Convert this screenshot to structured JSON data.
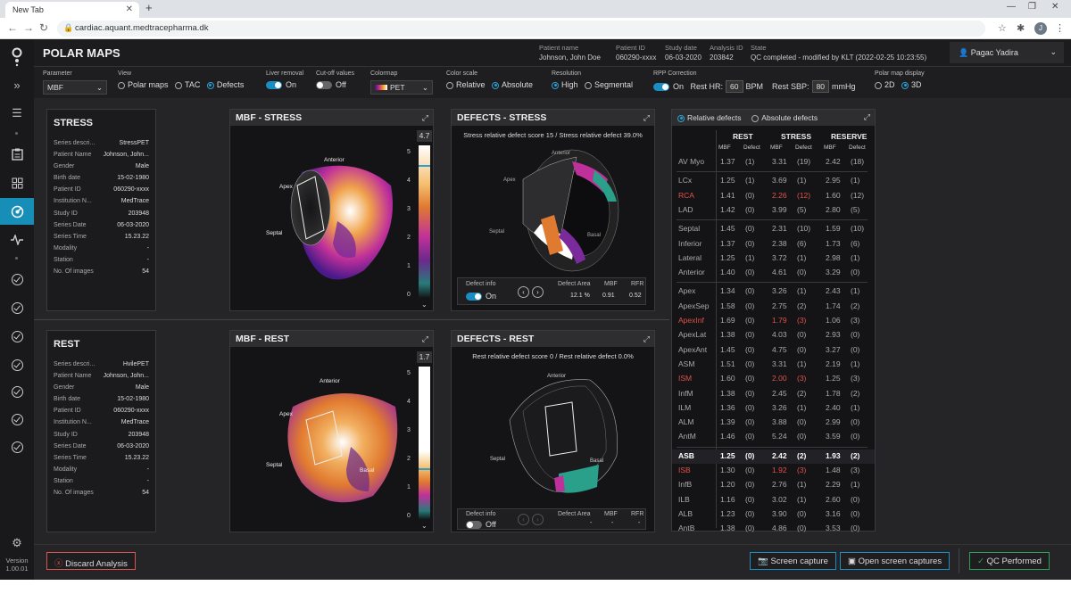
{
  "browser": {
    "tab_title": "New Tab",
    "url": "cardiac.aquant.medtracepharma.dk",
    "profile_initial": "J"
  },
  "app": {
    "title": "POLAR MAPS",
    "version_label": "Version",
    "version": "1.00.01"
  },
  "patient": {
    "name_label": "Patient name",
    "name": "Johnson, John Doe",
    "id_label": "Patient ID",
    "id": "060290-xxxx",
    "date_label": "Study date",
    "date": "06-03-2020",
    "analysis_label": "Analysis ID",
    "analysis": "203842",
    "state_label": "State",
    "state": "QC completed - modified by KLT  (2022-02-25 10:23:55)"
  },
  "user": {
    "name": "Pagac Yadira"
  },
  "params": {
    "parameter_label": "Parameter",
    "parameter_value": "MBF",
    "view_label": "View",
    "view_options": [
      "Polar maps",
      "TAC",
      "Defects"
    ],
    "liver_label": "Liver removal",
    "liver_state": "On",
    "cutoff_label": "Cut-off values",
    "cutoff_state": "Off",
    "colormap_label": "Colormap",
    "colormap_value": "PET",
    "colorscale_label": "Color scale",
    "colorscale_options": [
      "Relative",
      "Absolute"
    ],
    "resolution_label": "Resolution",
    "resolution_options": [
      "High",
      "Segmental"
    ],
    "rpp_label": "RPP Correction",
    "rpp_state": "On",
    "resthr_label": "Rest HR:",
    "resthr_value": "60",
    "resthr_unit": "BPM",
    "restsbp_label": "Rest SBP:",
    "restsbp_value": "80",
    "restsbp_unit": "mmHg",
    "polar_label": "Polar map display",
    "polar_options": [
      "2D",
      "3D"
    ]
  },
  "stress_info": {
    "title": "STRESS",
    "rows": [
      {
        "k": "Series descri...",
        "v": "StressPET"
      },
      {
        "k": "Patient Name",
        "v": "Johnson, John..."
      },
      {
        "k": "Gender",
        "v": "Male"
      },
      {
        "k": "Birth date",
        "v": "15-02-1980"
      },
      {
        "k": "Patient ID",
        "v": "060290-xxxx"
      },
      {
        "k": "Institution N...",
        "v": "MedTrace"
      },
      {
        "k": "Study ID",
        "v": "203948"
      },
      {
        "k": "Series Date",
        "v": "06-03-2020"
      },
      {
        "k": "Series Time",
        "v": "15.23.22"
      },
      {
        "k": "Modality",
        "v": "-"
      },
      {
        "k": "Station",
        "v": "-"
      },
      {
        "k": "No. Of images",
        "v": "54"
      }
    ]
  },
  "rest_info": {
    "title": "REST",
    "rows": [
      {
        "k": "Series descri...",
        "v": "HvilePET"
      },
      {
        "k": "Patient Name",
        "v": "Johnson, John..."
      },
      {
        "k": "Gender",
        "v": "Male"
      },
      {
        "k": "Birth date",
        "v": "15-02-1980"
      },
      {
        "k": "Patient ID",
        "v": "060290-xxxx"
      },
      {
        "k": "Institution N...",
        "v": "MedTrace"
      },
      {
        "k": "Study ID",
        "v": "203948"
      },
      {
        "k": "Series Date",
        "v": "06-03-2020"
      },
      {
        "k": "Series Time",
        "v": "15.23.22"
      },
      {
        "k": "Modality",
        "v": "-"
      },
      {
        "k": "Station",
        "v": "-"
      },
      {
        "k": "No. Of images",
        "v": "54"
      }
    ]
  },
  "mbf_stress": {
    "title": "MBF - STRESS",
    "max": "4.7",
    "ticks": [
      "5",
      "4",
      "3",
      "2",
      "1",
      "0"
    ],
    "labels": {
      "anterior": "Anterior",
      "apex": "Apex",
      "septal": "Septal"
    }
  },
  "mbf_rest": {
    "title": "MBF  - REST",
    "max": "1.7",
    "ticks": [
      "5",
      "4",
      "3",
      "2",
      "1",
      "0"
    ],
    "labels": {
      "anterior": "Anterior",
      "apex": "Apex",
      "septal": "Septal",
      "basal": "Basal"
    }
  },
  "def_stress": {
    "title": "DEFECTS - STRESS",
    "caption": "Stress relative defect score 15 / Stress relative defect 39.0%",
    "labels": {
      "anterior": "Anterior",
      "apex": "Apex",
      "septal": "Septal",
      "basal": "Basal"
    },
    "info_label": "Defect info",
    "info_state": "On",
    "area_label": "Defect Area",
    "area": "12.1 %",
    "mbf_label": "MBF",
    "mbf": "0.91",
    "rfr_label": "RFR",
    "rfr": "0.52"
  },
  "def_rest": {
    "title": "DEFECTS - REST",
    "caption": "Rest relative defect score 0 / Rest relative defect 0.0%",
    "labels": {
      "anterior": "Anterior",
      "septal": "Septal",
      "basal": "Basal"
    },
    "info_label": "Defect info",
    "info_state": "Off",
    "area_label": "Defect Area",
    "area": "-",
    "mbf_label": "MBF",
    "mbf": "-",
    "rfr_label": "RFR",
    "rfr": "-"
  },
  "table": {
    "options": [
      "Relative defects",
      "Absolute defects"
    ],
    "groups": [
      "REST",
      "STRESS",
      "RESERVE"
    ],
    "subheads": [
      "MBF",
      "Defect",
      "MBF",
      "Defect",
      "MBF",
      "Defect"
    ],
    "rows": [
      [
        "AV Myo",
        "1.37",
        "(1)",
        "3.31",
        "(19)",
        "2.42",
        "(18)"
      ],
      [
        "LCx",
        "1.25",
        "(1)",
        "3.69",
        "(1)",
        "2.95",
        "(1)"
      ],
      [
        "RCA",
        "1.41",
        "(0)",
        "2.26",
        "(12)",
        "1.60",
        "(12)"
      ],
      [
        "LAD",
        "1.42",
        "(0)",
        "3.99",
        "(5)",
        "2.80",
        "(5)"
      ],
      [
        "Septal",
        "1.45",
        "(0)",
        "2.31",
        "(10)",
        "1.59",
        "(10)"
      ],
      [
        "Inferior",
        "1.37",
        "(0)",
        "2.38",
        "(6)",
        "1.73",
        "(6)"
      ],
      [
        "Lateral",
        "1.25",
        "(1)",
        "3.72",
        "(1)",
        "2.98",
        "(1)"
      ],
      [
        "Anterior",
        "1.40",
        "(0)",
        "4.61",
        "(0)",
        "3.29",
        "(0)"
      ],
      [
        "Apex",
        "1.34",
        "(0)",
        "3.26",
        "(1)",
        "2.43",
        "(1)"
      ],
      [
        "ApexSep",
        "1.58",
        "(0)",
        "2.75",
        "(2)",
        "1.74",
        "(2)"
      ],
      [
        "ApexInf",
        "1.69",
        "(0)",
        "1.79",
        "(3)",
        "1.06",
        "(3)"
      ],
      [
        "ApexLat",
        "1.38",
        "(0)",
        "4.03",
        "(0)",
        "2.93",
        "(0)"
      ],
      [
        "ApexAnt",
        "1.45",
        "(0)",
        "4.75",
        "(0)",
        "3.27",
        "(0)"
      ],
      [
        "ASM",
        "1.51",
        "(0)",
        "3.31",
        "(1)",
        "2.19",
        "(1)"
      ],
      [
        "ISM",
        "1.60",
        "(0)",
        "2.00",
        "(3)",
        "1.25",
        "(3)"
      ],
      [
        "InfM",
        "1.38",
        "(0)",
        "2.45",
        "(2)",
        "1.78",
        "(2)"
      ],
      [
        "ILM",
        "1.36",
        "(0)",
        "3.26",
        "(1)",
        "2.40",
        "(1)"
      ],
      [
        "ALM",
        "1.39",
        "(0)",
        "3.88",
        "(0)",
        "2.99",
        "(0)"
      ],
      [
        "AntM",
        "1.46",
        "(0)",
        "5.24",
        "(0)",
        "3.59",
        "(0)"
      ],
      [
        "ASB",
        "1.25",
        "(0)",
        "2.42",
        "(2)",
        "1.93",
        "(2)"
      ],
      [
        "ISB",
        "1.30",
        "(0)",
        "1.92",
        "(3)",
        "1.48",
        "(3)"
      ],
      [
        "InfB",
        "1.20",
        "(0)",
        "2.76",
        "(1)",
        "2.29",
        "(1)"
      ],
      [
        "ILB",
        "1.16",
        "(0)",
        "3.02",
        "(1)",
        "2.60",
        "(0)"
      ],
      [
        "ALB",
        "1.23",
        "(0)",
        "3.90",
        "(0)",
        "3.16",
        "(0)"
      ],
      [
        "AntB",
        "1.38",
        "(0)",
        "4.86",
        "(0)",
        "3.53",
        "(0)"
      ]
    ],
    "red_rows": [
      "RCA",
      "ApexInf",
      "ISM",
      "ISB"
    ],
    "bold_rows": [
      "ASB"
    ]
  },
  "bottom": {
    "discard": "Discard Analysis",
    "capture": "Screen capture",
    "open_captures": "Open screen captures",
    "qc": "QC Performed"
  },
  "colors": {
    "accent": "#168eb8",
    "danger": "#e0524c",
    "success": "#2aa05a"
  }
}
